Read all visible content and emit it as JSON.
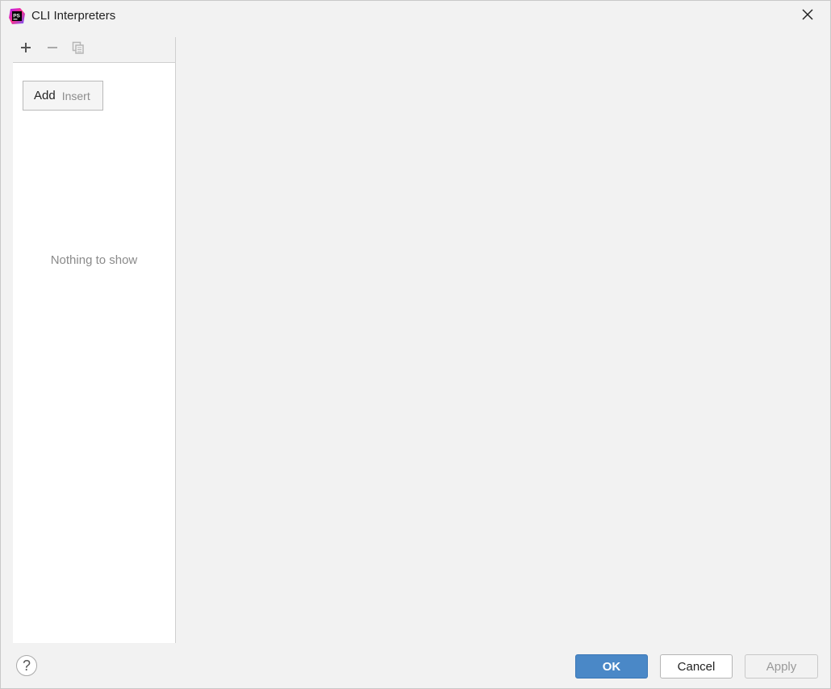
{
  "window": {
    "title": "CLI Interpreters",
    "app_icon": "phpstorm-icon",
    "close_icon": "close-icon"
  },
  "toolbar": {
    "add_icon": "plus-icon",
    "remove_icon": "minus-icon",
    "copy_icon": "copy-icon"
  },
  "list": {
    "popup_action_label": "Add",
    "popup_action_hint": "Insert",
    "empty_text": "Nothing to show"
  },
  "footer": {
    "help_label": "?",
    "ok_label": "OK",
    "cancel_label": "Cancel",
    "apply_label": "Apply"
  },
  "colors": {
    "accent": "#4a88c7",
    "background": "#f2f2f2",
    "list_background": "#ffffff"
  }
}
